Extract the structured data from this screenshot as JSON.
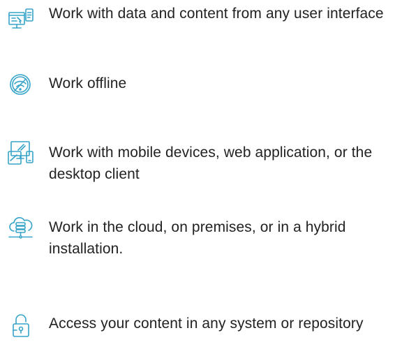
{
  "features": [
    {
      "icon": "ui-data-icon",
      "text": "Work with data and content from any user interface"
    },
    {
      "icon": "offline-icon",
      "text": "Work offline"
    },
    {
      "icon": "devices-icon",
      "text": "Work with mobile devices, web application, or the desktop client"
    },
    {
      "icon": "cloud-server-icon",
      "text": "Work in the cloud, on premises, or in a hybrid installation."
    },
    {
      "icon": "lock-icon",
      "text": "Access your content in any system or repository"
    }
  ],
  "colors": {
    "icon_accent": "#36a3c9",
    "text": "#222222"
  }
}
